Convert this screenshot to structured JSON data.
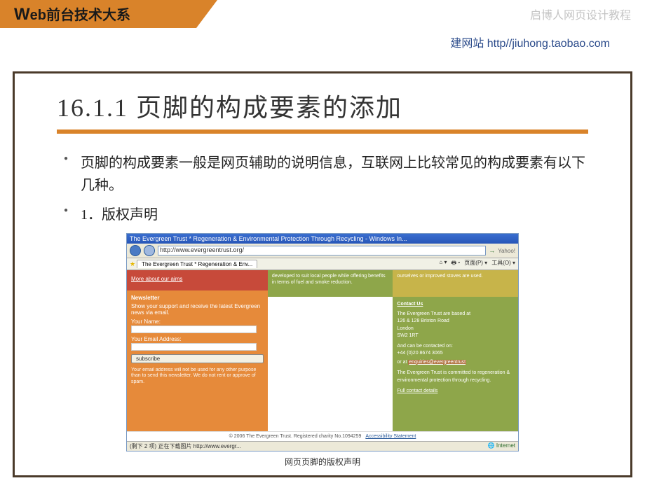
{
  "header": {
    "left_text": "Web前台技术大系",
    "right_text": "启博人网页设计教程",
    "subheader": "建网站 http//jiuhong.taobao.com"
  },
  "slide": {
    "title": "16.1.1  页脚的构成要素的添加",
    "bullets": [
      "页脚的构成要素一般是网页辅助的说明信息，互联网上比较常见的构成要素有以下几种。",
      "1．版权声明"
    ],
    "caption": "网页页脚的版权声明"
  },
  "browser": {
    "title": "The Evergreen Trust  *  Regeneration & Environmental Protection Through Recycling - Windows In...",
    "address": "http://www.evergreentrust.org/",
    "tab_label": "The Evergreen Trust  *  Regeneration & Env...",
    "tools": [
      "页面(P) ▾",
      "工具(O) ▾"
    ],
    "status_left": "(剩下 2 项)  正在下载图片 http://www.evergr...",
    "status_right": "Internet"
  },
  "page": {
    "left": {
      "aims_link": "More about our aims",
      "newsletter_head": "Newsletter",
      "newsletter_text": "Show your support and receive the latest Evergreen news via email.",
      "name_label": "Your Name:",
      "email_label": "Your Email Address:",
      "subscribe": "subscribe",
      "fineprint": "Your email address will not be used for any other purpose than to send this newsletter. We do not rent or approve of spam."
    },
    "mid_top": "developed to suit local people while offering benefits in terms of fuel and smoke reduction.",
    "right_top": "ourselves or improved stoves are used.",
    "right": {
      "head": "Contact Us",
      "line1": "The Evergreen Trust are based at",
      "addr1": "126 & 128 Brixton Road",
      "addr2": "London",
      "addr3": "SW2 1RT",
      "contacted": "And can be contacted on:",
      "phone": "+44 (0)20 8674 3065",
      "orat": "or at",
      "email": "enquiries@evergreentrust",
      "commit": "The Evergreen Trust is committed to regeneration & environmental protection through recycling.",
      "full": "Full contact details"
    },
    "footer": "© 2006 The Evergreen Trust. Registered charity No.1094259",
    "footer_acc": "Accessibility Statement"
  }
}
